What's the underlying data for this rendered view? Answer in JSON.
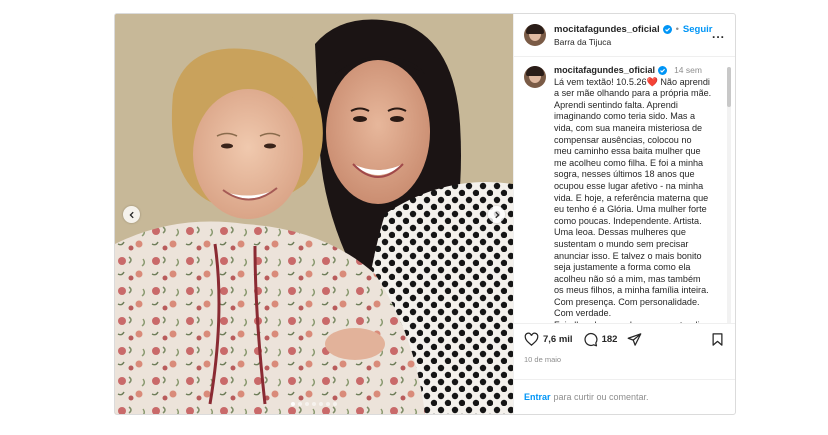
{
  "post": {
    "header": {
      "username": "mocitafagundes_oficial",
      "separator": "•",
      "follow_label": "Seguir",
      "location": "Barra da Tijuca",
      "more_label": "..."
    },
    "caption": {
      "username": "mocitafagundes_oficial",
      "time": "14 sem",
      "lines": [
        "Lá vem textão! 10.5.26❤️ Não aprendi",
        "a ser mãe olhando para a própria mãe.",
        "Aprendi sentindo falta. Aprendi",
        "imaginando como teria sido. Mas a",
        "vida, com sua maneira misteriosa de",
        "compensar ausências,  colocou no",
        "meu caminho essa baita mulher que",
        "me acolheu como filha. E foi a minha",
        "sogra, nesses últimos 18 anos que",
        "ocupou esse lugar afetivo - na minha",
        "vida. E hoje, a referência materna que",
        "eu tenho é a Glória. Uma mulher forte",
        "como poucas. Independente. Artista.",
        "Uma leoa. Dessas mulheres que",
        "sustentam o mundo sem precisar",
        "anunciar isso. E talvez o mais bonito",
        "seja justamente a forma como ela",
        "acolheu não só a mim, mas também",
        "os meus filhos, a minha família inteira.",
        "Com presença. Com personalidade.",
        "Com verdade.",
        "Foi olhando para ela que eu entendi"
      ]
    },
    "actions": {
      "likes": "7,6 mil",
      "comments": "182",
      "date": "10 de maio"
    },
    "comment_box": {
      "link": "Entrar",
      "text": "para curtir ou comentar."
    },
    "carousel": {
      "slides": 7,
      "active_slide": 1
    },
    "colors": {
      "accent": "#0095f6",
      "text": "#262626",
      "muted": "#8e8e8e",
      "heart": "#e0245e"
    },
    "icons": [
      "chevron-left-icon",
      "chevron-right-icon",
      "heart-icon",
      "comment-icon",
      "share-icon",
      "bookmark-icon",
      "verified-badge-icon",
      "more-icon"
    ]
  }
}
